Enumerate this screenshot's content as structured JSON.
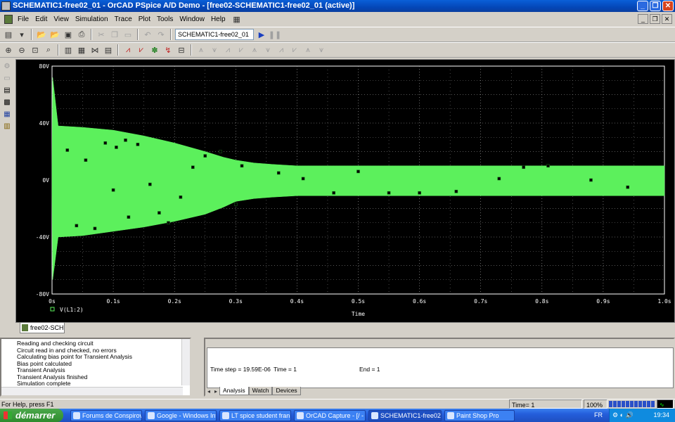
{
  "window": {
    "title": "SCHEMATIC1-free02_01 - OrCAD PSpice A/D Demo  - [free02-SCHEMATIC1-free02_01 (active)]"
  },
  "menu": [
    "File",
    "Edit",
    "View",
    "Simulation",
    "Trace",
    "Plot",
    "Tools",
    "Window",
    "Help"
  ],
  "toolbar": {
    "profile_value": "SCHEMATIC1-free02_01"
  },
  "chart_data": {
    "type": "line",
    "title": "",
    "xlabel": "Time",
    "ylabel": "",
    "xlim": [
      0,
      1.0
    ],
    "ylim": [
      -80,
      80
    ],
    "x_ticks": [
      "0s",
      "0.1s",
      "0.2s",
      "0.3s",
      "0.4s",
      "0.5s",
      "0.6s",
      "0.7s",
      "0.8s",
      "0.9s",
      "1.0s"
    ],
    "y_ticks": [
      "80V",
      "40V",
      "0V",
      "-40V",
      "-80V"
    ],
    "grid": true,
    "legend_position": "bottom-left",
    "series": [
      {
        "name": "V(L1:2)",
        "color": "#5cf05c",
        "envelope_x": [
          0,
          0.001,
          0.01,
          0.05,
          0.1,
          0.15,
          0.2,
          0.25,
          0.28,
          0.3,
          0.33,
          0.36,
          0.4,
          0.5,
          0.6,
          0.7,
          0.8,
          0.9,
          1.0
        ],
        "envelope_upper": [
          10,
          72,
          38,
          37,
          35,
          31,
          26,
          20,
          16,
          14,
          12,
          11,
          10,
          10,
          10,
          10,
          10,
          10,
          10
        ],
        "envelope_lower": [
          -10,
          -70,
          -40,
          -39,
          -36,
          -33,
          -29,
          -24,
          -19,
          -15,
          -13,
          -12,
          -11,
          -11,
          -11,
          -11,
          -11,
          -11,
          -11
        ],
        "markers_x": [
          0.025,
          0.04,
          0.055,
          0.07,
          0.087,
          0.1,
          0.105,
          0.12,
          0.125,
          0.14,
          0.16,
          0.175,
          0.19,
          0.21,
          0.23,
          0.25,
          0.275,
          0.3,
          0.31,
          0.37,
          0.41,
          0.46,
          0.5,
          0.55,
          0.6,
          0.66,
          0.73,
          0.77,
          0.81,
          0.88,
          0.94
        ],
        "markers_y": [
          21,
          -32,
          14,
          -34,
          26,
          -7,
          23,
          28,
          -26,
          25,
          -3,
          -23,
          -30,
          -12,
          9,
          17,
          20,
          -17,
          10,
          5,
          1,
          -9,
          6,
          -9,
          -9,
          -8,
          1,
          9,
          10,
          0,
          -5
        ]
      }
    ]
  },
  "doc_tab": "free02-SCHE...",
  "output_lines": [
    "Reading and checking circuit",
    "Circuit read in and checked, no errors",
    "Calculating bias point for Transient Analysis",
    "Bias point calculated",
    "Transient Analysis",
    "Transient Analysis finished",
    "Simulation complete"
  ],
  "sim_status": {
    "time_step": "Time step =  19.59E-06",
    "time": "Time = 1",
    "end": "End = 1"
  },
  "sim_tabs": [
    "Analysis",
    "Watch",
    "Devices"
  ],
  "statusbar": {
    "help": "For Help, press F1",
    "time": "Time= 1",
    "zoom": "100%"
  },
  "taskbar": {
    "start": "démarrer",
    "tasks": [
      "Forums de Conspirov...",
      "Google - Windows Int...",
      "LT spice student fran...",
      "OrCAD Capture - [/ - ...",
      "SCHEMATIC1-free02...",
      "Paint Shop Pro"
    ],
    "lang": "FR",
    "clock": "19:34"
  }
}
